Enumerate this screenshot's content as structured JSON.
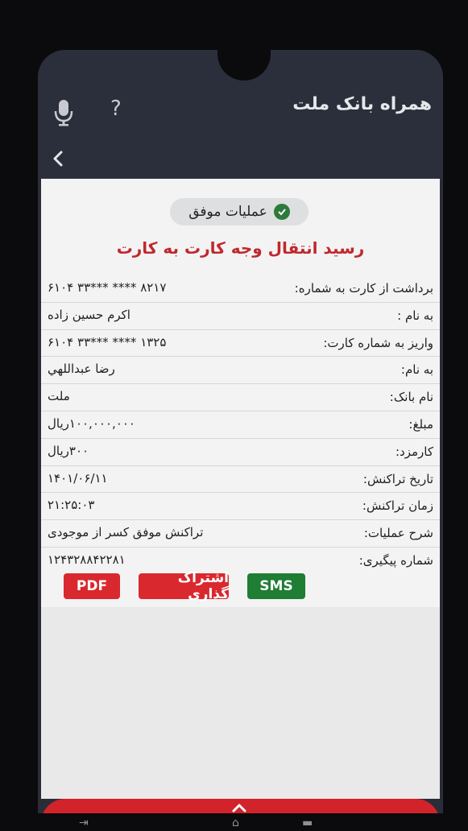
{
  "app": {
    "title": "همراه بانک ملت",
    "help_icon": "?"
  },
  "status": {
    "label": "عملیات موفق"
  },
  "receipt": {
    "title": "رسید انتقال وجه کارت به کارت",
    "rows": [
      {
        "label": "برداشت از کارت به شماره:",
        "value": "۸۲۱۷ **** ***۳۳ ۶۱۰۴"
      },
      {
        "label": "به نام :",
        "value": "اکرم حسین زاده"
      },
      {
        "label": "واریز به شماره کارت:",
        "value": "۱۳۲۵ **** ***۳۳ ۶۱۰۴"
      },
      {
        "label": "به نام:",
        "value": "رضا عبداللهي"
      },
      {
        "label": "نام بانک:",
        "value": "ملت"
      },
      {
        "label": "مبلغ:",
        "value": "۱۰۰,۰۰۰,۰۰۰ریال"
      },
      {
        "label": "کارمزد:",
        "value": "۳۰۰ریال"
      },
      {
        "label": "تاریخ تراکنش:",
        "value": "۱۴۰۱/۰۶/۱۱"
      },
      {
        "label": "زمان تراکنش:",
        "value": "۲۱:۲۵:۰۳"
      },
      {
        "label": "شرح عملیات:",
        "value": "تراکنش موفق کسر از موجودی"
      },
      {
        "label": "شماره پیگیری:",
        "value": "۱۲۴۳۲۸۸۴۲۲۸۱"
      }
    ]
  },
  "actions": {
    "sms": "SMS",
    "share": "اشتراک گذاری",
    "pdf": "PDF"
  },
  "colors": {
    "accent_red": "#d9282e",
    "sms_green": "#1f7d34",
    "header": "#2b2f3b"
  }
}
